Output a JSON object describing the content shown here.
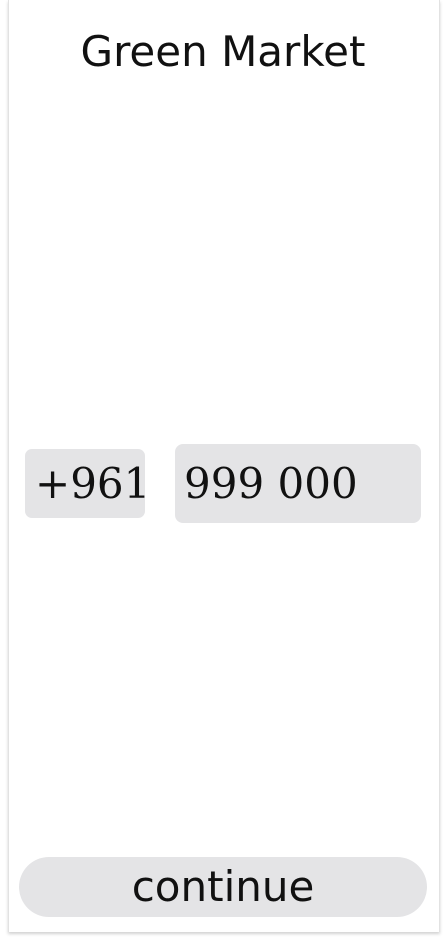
{
  "app": {
    "title": "Green Market"
  },
  "login": {
    "country_code": "+961",
    "phone_value": "999 000",
    "continue_label": "continue"
  },
  "colors": {
    "background": "#ffffff",
    "field_background": "#e4e4e6",
    "text": "#111111"
  }
}
